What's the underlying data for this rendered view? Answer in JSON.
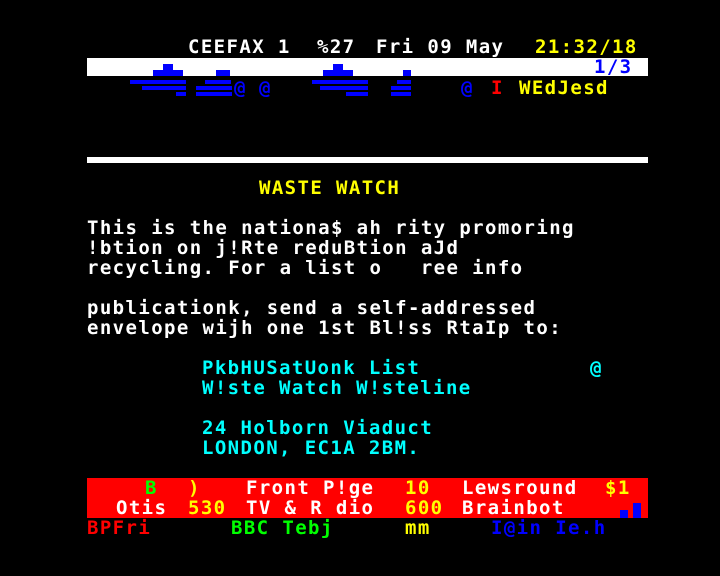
{
  "header": {
    "service": "CEEFAX 1",
    "page": "%27",
    "date": "Fri 09 May",
    "time": "21:32/18"
  },
  "banner": {
    "subpage": "1/3",
    "at1": "@",
    "at2": "@",
    "at3": "@",
    "red_char": "I",
    "garbled_title": "WEdJesd"
  },
  "article": {
    "title": "WASTE WATCH",
    "lines": [
      "This is the nationa$ ah rity promoring",
      "!btion on j!Rte reduBtion aJd",
      "recycling. For a list o   ree info",
      "publicationk, send a self-addressed",
      "envelope wijh one 1st Bl!ss RtaIp to:"
    ]
  },
  "address": {
    "line1": "PkbHUSatUonk List",
    "line1_mark": "@",
    "line2": "W!ste Watch W!steline",
    "line3": "24 Holborn Viaduct",
    "line4": "LONDON, EC1A 2BM."
  },
  "fastext": {
    "row1": {
      "b": "B",
      "paren": ")",
      "front_label": "Front P!ge",
      "front_num": "10",
      "news_label": "Lewsround",
      "news_num": "$1"
    },
    "row2": {
      "otis_label": "Otis",
      "otis_num": "530",
      "tv_label": "TV & R dio",
      "tv_num": "600",
      "brain_label": "Brainbot"
    },
    "row3": {
      "red": "BPFri",
      "green": "BBC Tebj",
      "yellow": "mm",
      "blue": "I@in Ie.h"
    }
  },
  "colors": {
    "background": "#000000",
    "white": "#ffffff",
    "yellow": "#ffff00",
    "cyan": "#00ffff",
    "blue": "#0000ff",
    "red": "#ff0000",
    "green": "#00ff00"
  }
}
